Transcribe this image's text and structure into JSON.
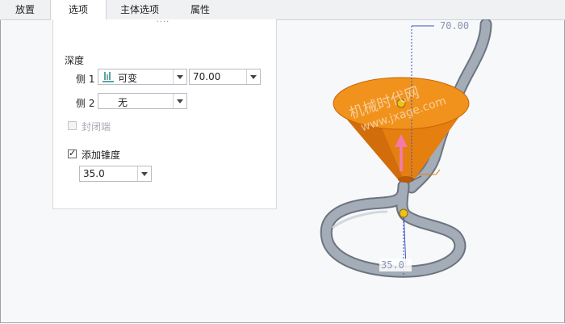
{
  "tabs": [
    {
      "label": "放置",
      "active": false
    },
    {
      "label": "选项",
      "active": true
    },
    {
      "label": "主体选项",
      "active": false
    },
    {
      "label": "属性",
      "active": false
    }
  ],
  "options": {
    "grip": "····",
    "depth_label": "深度",
    "side1": {
      "label": "侧 1",
      "type_value": "可变",
      "depth_value": "70.00"
    },
    "side2": {
      "label": "侧 2",
      "type_value": "无"
    },
    "capped_ends": {
      "label": "封闭端",
      "checked": false,
      "enabled": false
    },
    "add_taper": {
      "label": "添加锥度",
      "checked": true
    },
    "taper_value": "35.0"
  },
  "viewport": {
    "dim_top": "70.00",
    "dim_bottom": "35.0",
    "watermark": "机械时代网",
    "watermark2": "www.jxage.com",
    "colors": {
      "cone": "#ee8a14",
      "cone_dark": "#c9650a",
      "pipe": "#9aa3ae",
      "arrow": "#f27aa8",
      "handle": "#f2c01a"
    }
  }
}
